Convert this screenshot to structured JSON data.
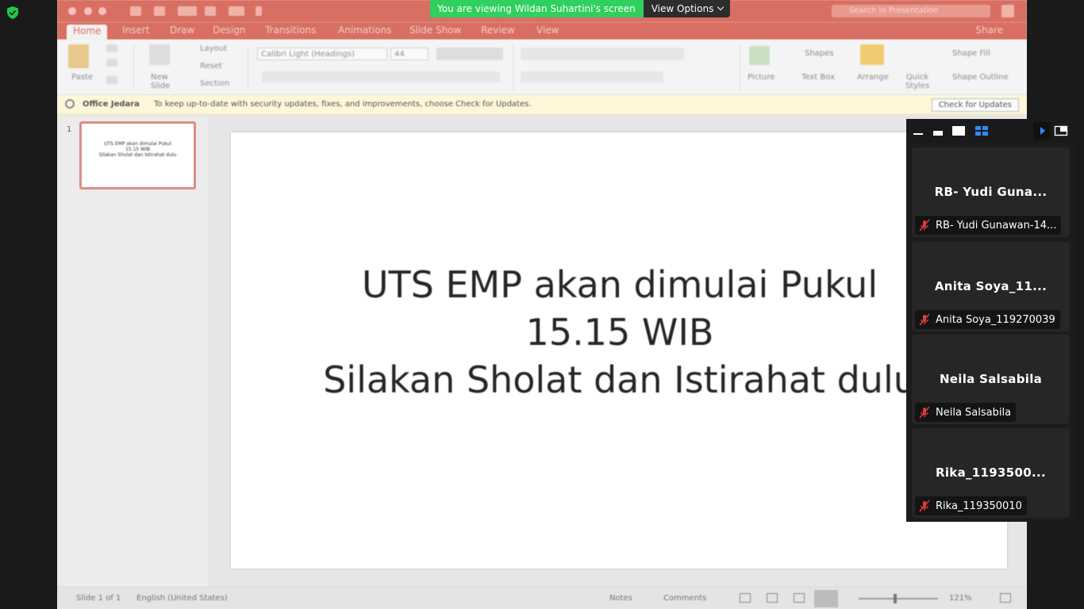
{
  "banner": {
    "viewing_text": "You are viewing Wildan Suhartini's screen",
    "view_options_label": "View Options"
  },
  "ppt": {
    "tabs": [
      "Home",
      "Insert",
      "Draw",
      "Design",
      "Transitions",
      "Animations",
      "Slide Show",
      "Review",
      "View"
    ],
    "share_label": "Share",
    "search_placeholder": "Search in Presentation",
    "ribbon": {
      "paste": "Paste",
      "new_slide": "New Slide",
      "layout": "Layout",
      "reset": "Reset",
      "section": "Section",
      "font": "Calibri Light (Headings)",
      "font_size": "44",
      "picture": "Picture",
      "shapes": "Shapes",
      "text_box": "Text Box",
      "arrange": "Arrange",
      "quick_styles": "Quick Styles",
      "shape_fill": "Shape Fill",
      "shape_outline": "Shape Outline"
    },
    "message_bar": {
      "title": "Office Jedara",
      "text": "To keep up-to-date with security updates, fixes, and improvements, choose Check for Updates.",
      "button": "Check for Updates"
    },
    "thumbnail": {
      "number": "1",
      "lines": [
        "UTS EMP akan dimulai Pukul",
        "15.15 WIB",
        "Silakan Sholat dan Istirahat dulu"
      ]
    },
    "slide": {
      "lines": [
        "UTS EMP akan dimulai Pukul",
        "15.15 WIB",
        "Silakan Sholat dan Istirahat dulu"
      ]
    },
    "status": {
      "slide_count": "Slide 1 of 1",
      "language": "English (United States)",
      "notes": "Notes",
      "comments": "Comments",
      "zoom": "121%"
    }
  },
  "participants": [
    {
      "tile_name": "RB- Yudi Guna...",
      "label": "RB- Yudi Gunawan-14..."
    },
    {
      "tile_name": "Anita Soya_11...",
      "label": "Anita Soya_119270039"
    },
    {
      "tile_name": "Neila Salsabila",
      "label": "Neila Salsabila"
    },
    {
      "tile_name": "Rika_1193500...",
      "label": "Rika_119350010"
    }
  ],
  "colors": {
    "banner_green": "#2fd05d",
    "ppt_accent": "#d86f62",
    "mute_red": "#e0393e",
    "shield_green": "#23c552"
  }
}
